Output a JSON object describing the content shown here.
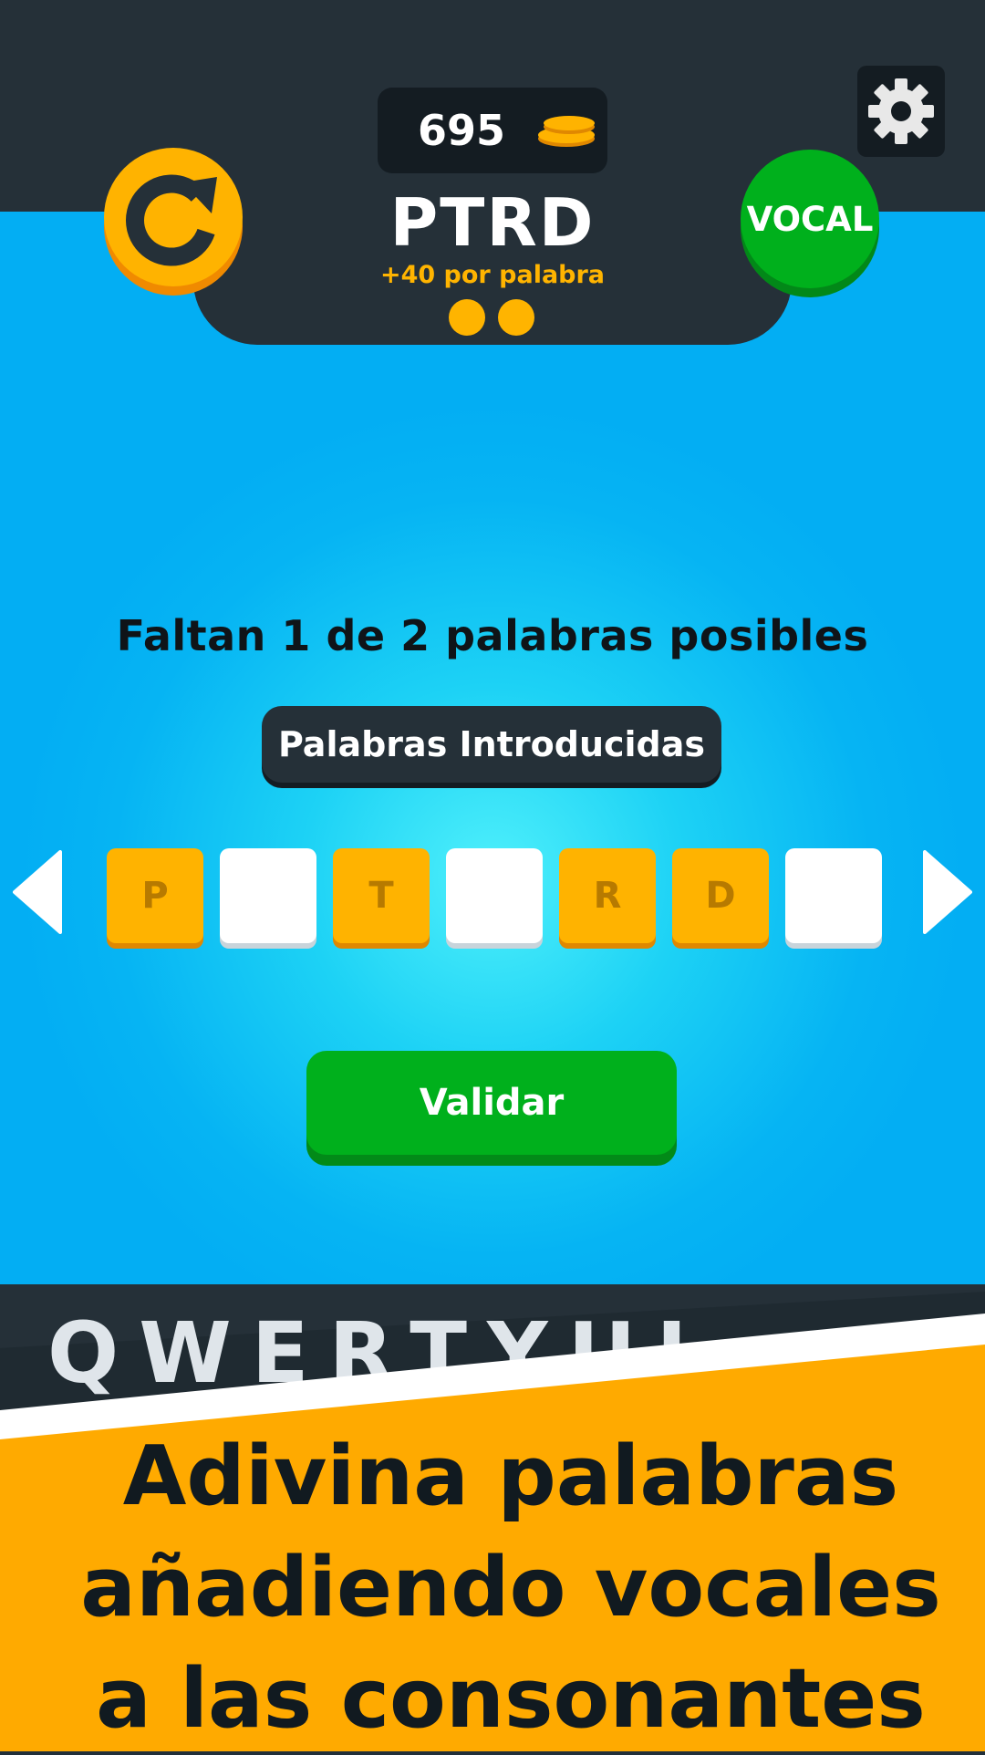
{
  "header": {
    "coins": "695",
    "consonants": "PTRD",
    "reward_text": "+40 por palabra",
    "words_total_dots": 2,
    "vocal_button_label": "VOCAL",
    "refresh_icon": "refresh-icon",
    "settings_icon": "gear-icon",
    "coin_icon": "coin-stack-icon"
  },
  "main": {
    "missing_text": "Faltan 1 de 2 palabras posibles",
    "entered_words_label": "Palabras Introducidas",
    "tiles": [
      {
        "letter": "P",
        "kind": "letter"
      },
      {
        "letter": "",
        "kind": "empty"
      },
      {
        "letter": "T",
        "kind": "letter"
      },
      {
        "letter": "",
        "kind": "empty"
      },
      {
        "letter": "R",
        "kind": "letter"
      },
      {
        "letter": "D",
        "kind": "letter"
      },
      {
        "letter": "",
        "kind": "empty"
      }
    ],
    "validate_label": "Validar"
  },
  "keyboard": {
    "visible_keys": "QWERTYUI"
  },
  "promo": {
    "line1": "Adivina palabras",
    "line2": "añadiendo vocales",
    "line3": "a las consonantes"
  },
  "colors": {
    "accent_orange": "#ffb300",
    "accent_green": "#00b01c",
    "dark_panel": "#253038",
    "sky_blue": "#06b4f3"
  }
}
